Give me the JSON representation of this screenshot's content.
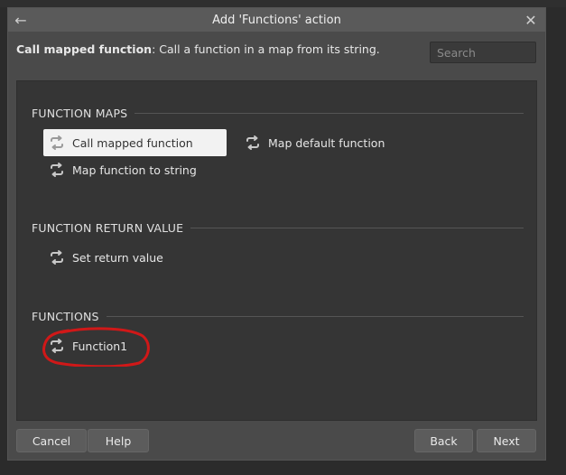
{
  "dialog": {
    "title": "Add 'Functions' action"
  },
  "header": {
    "desc_bold": "Call mapped function",
    "desc_rest": ": Call a function in a map from its string.",
    "search_placeholder": "Search"
  },
  "sections": {
    "maps": {
      "title": "FUNCTION MAPS",
      "items": [
        {
          "label": "Call mapped function"
        },
        {
          "label": "Map default function"
        },
        {
          "label": "Map function to string"
        }
      ]
    },
    "return": {
      "title": "FUNCTION RETURN VALUE",
      "items": [
        {
          "label": "Set return value"
        }
      ]
    },
    "functions": {
      "title": "FUNCTIONS",
      "items": [
        {
          "label": "Function1"
        }
      ]
    }
  },
  "footer": {
    "cancel": "Cancel",
    "help": "Help",
    "back": "Back",
    "next": "Next"
  },
  "colors": {
    "annotation": "#d01818"
  }
}
